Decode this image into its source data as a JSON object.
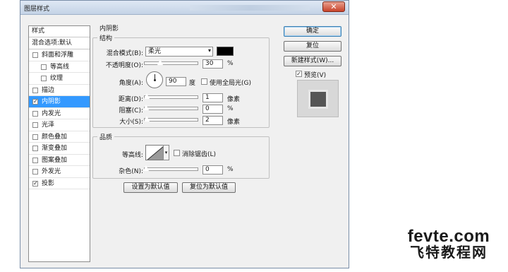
{
  "window": {
    "title": "图层样式",
    "close_symbol": "✕"
  },
  "left_panel": {
    "header": "样式",
    "blend_options": "混合选项:默认",
    "items": [
      {
        "label": "斜面和浮雕",
        "checked": false,
        "sub": false
      },
      {
        "label": "等高线",
        "checked": false,
        "sub": true
      },
      {
        "label": "纹理",
        "checked": false,
        "sub": true
      },
      {
        "label": "描边",
        "checked": false,
        "sub": false
      },
      {
        "label": "内阴影",
        "checked": true,
        "sub": false,
        "selected": true
      },
      {
        "label": "内发光",
        "checked": false,
        "sub": false
      },
      {
        "label": "光泽",
        "checked": false,
        "sub": false
      },
      {
        "label": "颜色叠加",
        "checked": false,
        "sub": false
      },
      {
        "label": "渐变叠加",
        "checked": false,
        "sub": false
      },
      {
        "label": "图案叠加",
        "checked": false,
        "sub": false
      },
      {
        "label": "外发光",
        "checked": false,
        "sub": false
      },
      {
        "label": "投影",
        "checked": true,
        "sub": false
      }
    ]
  },
  "section_title": "内阴影",
  "structure": {
    "title": "结构",
    "blend_mode_label": "混合模式(B):",
    "blend_mode_value": "柔光",
    "blend_color": "#000000",
    "opacity_label": "不透明度(O):",
    "opacity_value": "30",
    "opacity_unit": "%",
    "angle_label": "角度(A):",
    "angle_value": "90",
    "angle_unit": "度",
    "global_light_label": "使用全局光(G)",
    "distance_label": "距离(D):",
    "distance_value": "1",
    "distance_unit": "像素",
    "choke_label": "阻塞(C):",
    "choke_value": "0",
    "choke_unit": "%",
    "size_label": "大小(S):",
    "size_value": "2",
    "size_unit": "像素"
  },
  "quality": {
    "title": "品质",
    "contour_label": "等高线:",
    "anti_alias_label": "消除锯齿(L)",
    "noise_label": "杂色(N):",
    "noise_value": "0",
    "noise_unit": "%"
  },
  "buttons": {
    "make_default": "设置为默认值",
    "reset_default": "复位为默认值",
    "ok": "确定",
    "reset": "复位",
    "new_style": "新建样式(W)...",
    "preview_label": "预览(V)",
    "preview_checked": true
  },
  "watermark": {
    "line1": "fevte.com",
    "line2": "飞特教程网"
  }
}
